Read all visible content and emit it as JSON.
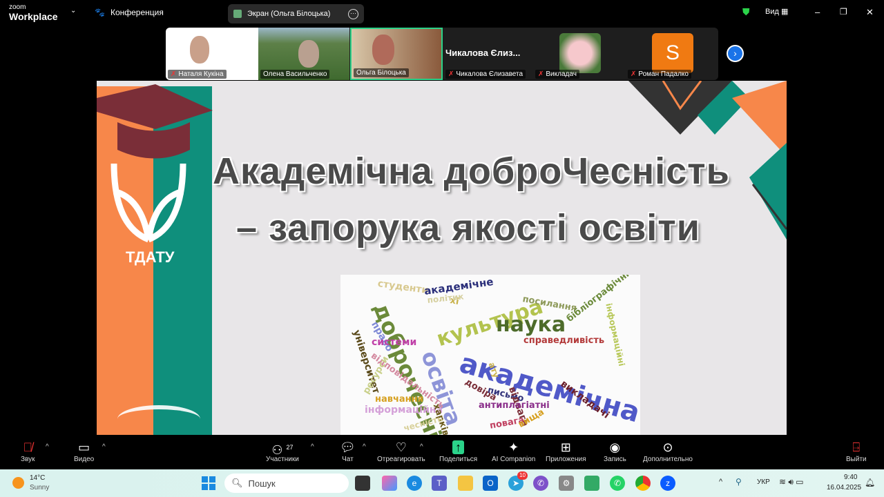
{
  "app": {
    "logo_small": "zoom",
    "logo_big": "Workplace",
    "meeting_label": "Конференция",
    "screen_share_label": "Экран (Ольга Білоцька)",
    "view_label": "Вид"
  },
  "participants": [
    {
      "name": "Наталя Кукіна",
      "muted": true
    },
    {
      "name": "Олена Васильченко",
      "muted": false
    },
    {
      "name": "Ольга Білоцька",
      "muted": false,
      "active": true
    },
    {
      "name": "Чикалова Єлизавета",
      "display": "Чикалова Єлиз...",
      "muted": true
    },
    {
      "name": "Викладач",
      "muted": true
    },
    {
      "name": "Роман Падалко",
      "avatar_letter": "S",
      "muted": true
    }
  ],
  "slide": {
    "title_line1": "Академічна доброЧесність",
    "title_line2": "– запорука якості освіти",
    "logo_text": "ТДАТУ",
    "cloud_words": [
      "студенти",
      "академічне",
      "хі",
      "політик",
      "культура",
      "посилання",
      "бібліографічні",
      "доброчесність",
      "наука",
      "право",
      "академічна",
      "справедливість",
      "інформаційні",
      "університет",
      "системи",
      "освіта",
      "відповідальність",
      "ату",
      "ресурси",
      "довіра",
      "письмо",
      "відвага",
      "викладачі",
      "навчання",
      "інформаційна",
      "антиплагіатні",
      "харків",
      "повага",
      "чесність",
      "вища"
    ]
  },
  "toolbar": {
    "audio": "Звук",
    "video": "Видео",
    "participants": "Участники",
    "participants_count": "27",
    "chat": "Чат",
    "react": "Отреагировать",
    "share": "Поделиться",
    "ai": "AI Companion",
    "apps": "Приложения",
    "record": "Запись",
    "more": "Дополнительно",
    "leave": "Выйти"
  },
  "taskbar": {
    "temp": "14°C",
    "weather": "Sunny",
    "search_placeholder": "Пошук",
    "telegram_badge": "10",
    "lang": "УКР",
    "time": "9:40",
    "date": "16.04.2025"
  },
  "colors": {
    "teal": "#0f8f7c",
    "orange": "#f7874a",
    "maroon": "#7a2e38",
    "accent_green": "#2bd38a"
  }
}
